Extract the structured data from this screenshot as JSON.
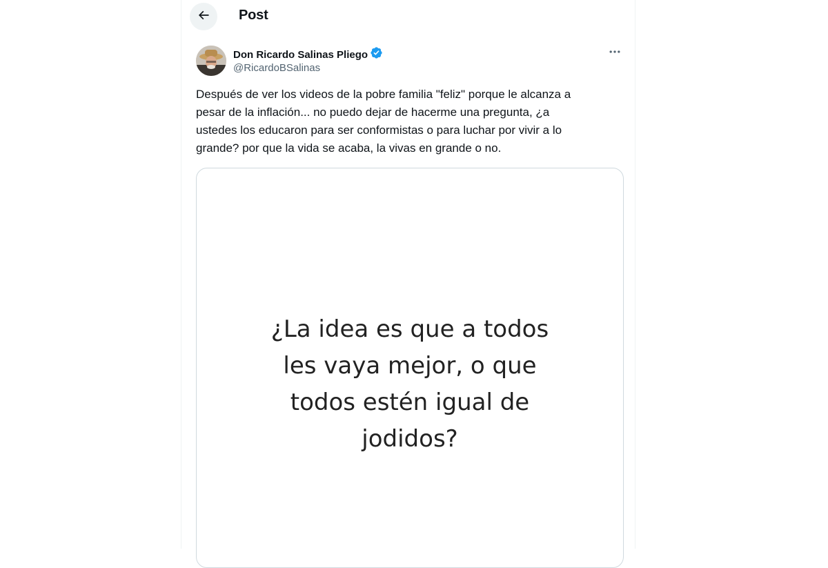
{
  "header": {
    "title": "Post",
    "back_icon": "arrow-left-icon"
  },
  "author": {
    "display_name": "Don Ricardo Salinas Pliego",
    "handle": "@RicardoBSalinas",
    "verified_icon": "verified-badge-icon",
    "verified_color": "#1d9bf0"
  },
  "post": {
    "text": "Después de ver los videos de la pobre familia \"feliz\" porque le alcanza a\npesar de la inflación... no puedo dejar de hacerme una pregunta, ¿a\nustedes los educaron para ser conformistas o para luchar por vivir a lo\ngrande? por que la vida se acaba, la vivas en grande o no.",
    "more_icon": "more-options-icon",
    "media_text": "¿La idea es que a todos\nles vaya mejor, o que\ntodos estén igual de\njodidos?"
  }
}
